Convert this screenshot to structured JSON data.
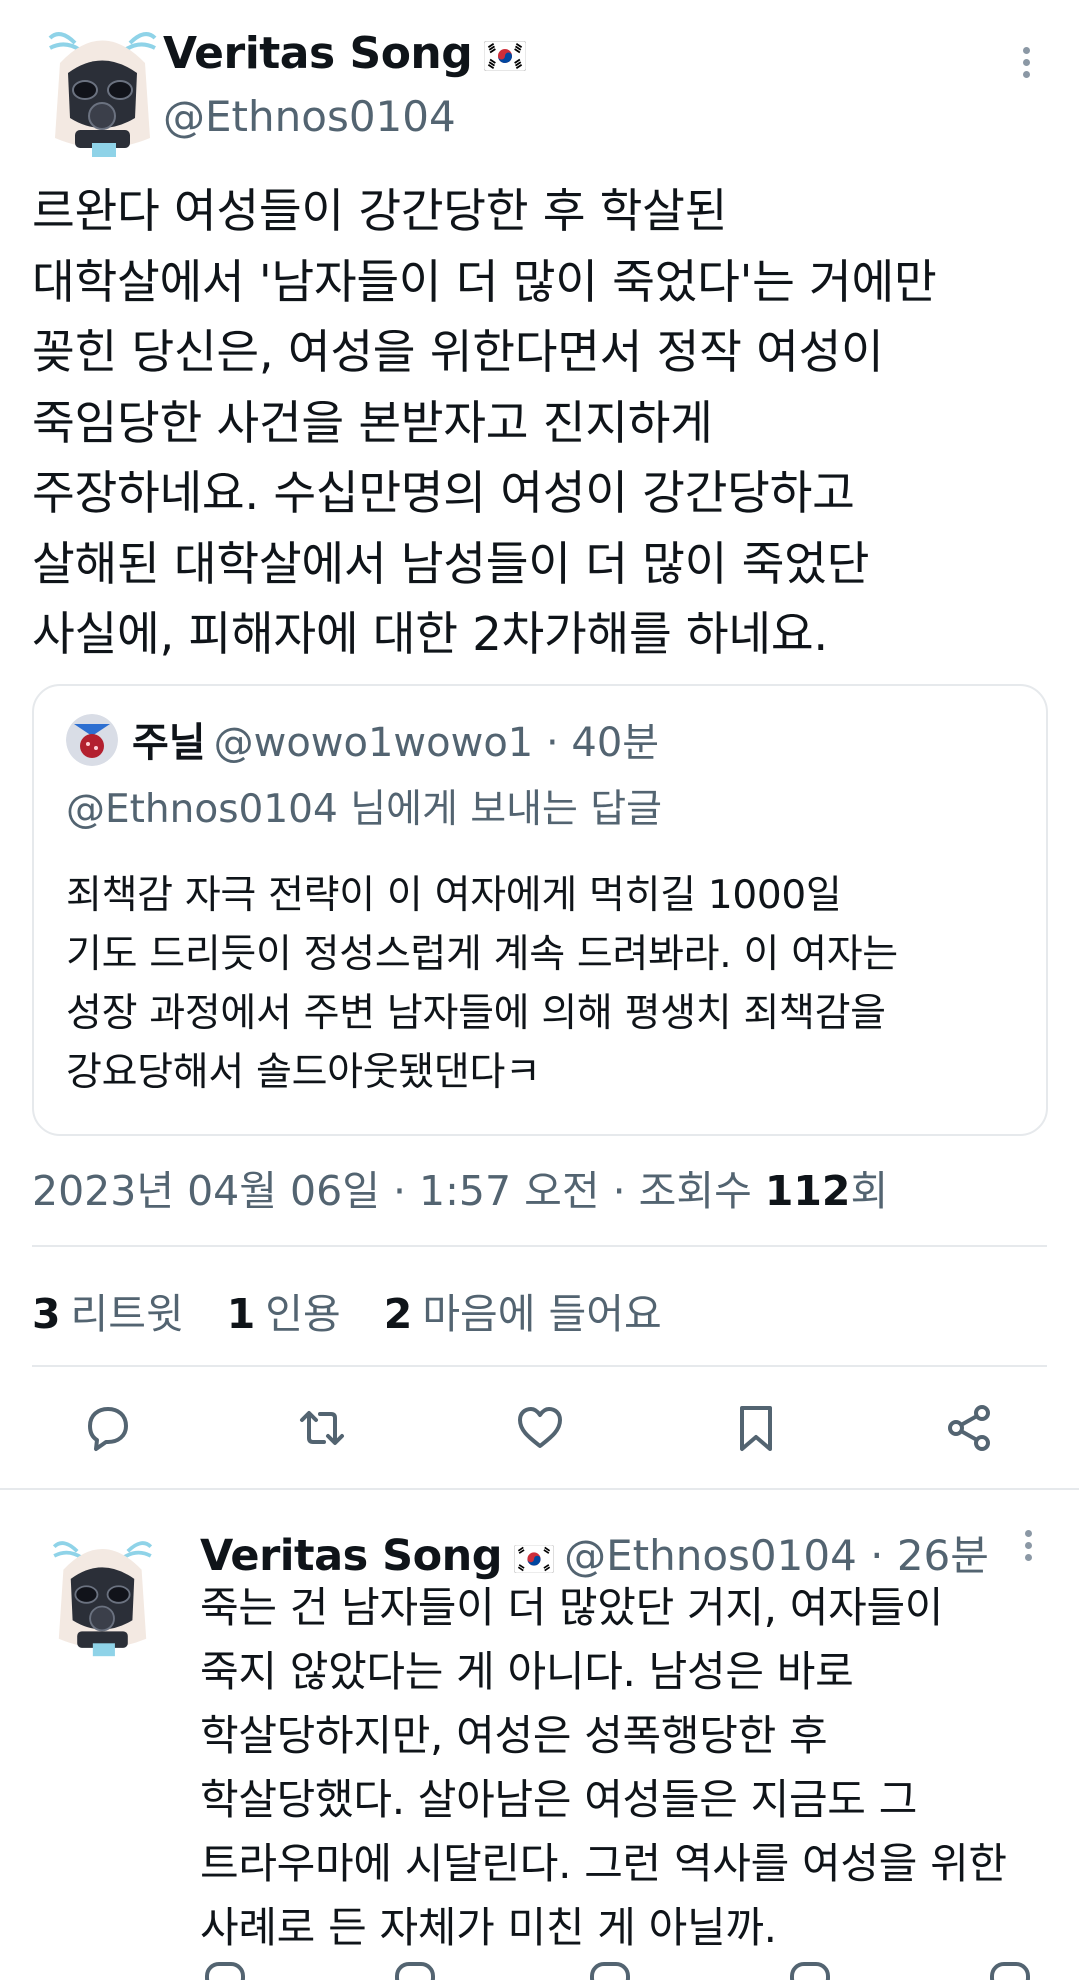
{
  "main_tweet": {
    "author_name": "Veritas Song",
    "author_handle": "@Ethnos0104",
    "flag_icon": "south-korea-flag-icon",
    "text": "르완다 여성들이 강간당한 후 학살된\n대학살에서 '남자들이 더 많이 죽었다'는 거에만\n꽂힌 당신은, 여성을 위한다면서 정작 여성이\n죽임당한 사건을 본받자고 진지하게\n주장하네요. 수십만명의 여성이 강간당하고\n살해된 대학살에서 남성들이 더 많이 죽었단\n사실에, 피해자에 대한 2차가해를 하네요.",
    "timestamp_prefix": "2023년 04월 06일 · 1:57 오전 · 조회수 ",
    "views": "112",
    "views_suffix": "회"
  },
  "quoted_tweet": {
    "author_name": "주닐",
    "handle_time": "@wowo1wowo1 · 40분",
    "reply_to": "@Ethnos0104 님에게 보내는 답글",
    "text": "죄책감 자극 전략이 이 여자에게 먹히길 1000일\n기도 드리듯이 정성스럽게 계속 드려봐라. 이 여자는\n성장 과정에서 주변 남자들에 의해 평생치 죄책감을\n강요당해서 솔드아웃됐댄다ㅋ"
  },
  "stats": {
    "retweets_count": "3",
    "retweets_label": "리트윗",
    "quotes_count": "1",
    "quotes_label": "인용",
    "likes_count": "2",
    "likes_label": "마음에 들어요"
  },
  "actions": [
    "reply-icon",
    "retweet-icon",
    "like-icon",
    "bookmark-icon",
    "share-icon"
  ],
  "reply_tweet": {
    "author_name": "Veritas Song",
    "handle_time": "@Ethnos0104 · 26분",
    "text": "죽는 건 남자들이 더 많았단 거지, 여자들이\n죽지 않았다는 게 아니다. 남성은 바로\n학살당하지만, 여성은 성폭행당한 후\n학살당했다. 살아남은 여성들은 지금도 그\n트라우마에 시달린다. 그런 역사를 여성을 위한\n사례로 든 자체가 미친 게 아닐까."
  },
  "colors": {
    "text": "#0f1419",
    "secondary": "#536471",
    "border": "#e6e9ec"
  }
}
